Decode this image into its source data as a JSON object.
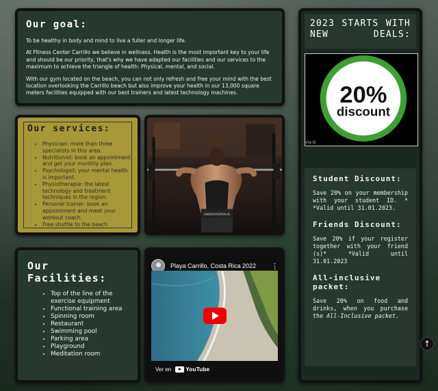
{
  "goal": {
    "title": "Our goal:",
    "paragraphs": [
      "To be healthy in body and mind to live a fuller and longer life.",
      "At Fitness Center Carrillo we believe in wellness. Health is the most important key to your life and should be our priority, that's why we have adapted our facilities and our services to the maximum to achieve the triangle of health: Physical, mental, and social.",
      "With our gym located on the beach, you can not only refresh and free your mind with the best location overlooking the Carrillo beach but also improve your health in our 13,000 square meters facilities equipped with our best trainers and latest technology machines."
    ]
  },
  "services": {
    "title": "Our services:",
    "items": [
      "Physician: more than three specialists in this area.",
      "Nutritionist: book an appointment and get your monthly plan.",
      "Psychologist: your mental health is important.",
      "Physiotherapie: the latest technology and treatment techniques in the region.",
      "Personal trainer: book an appointment and meet your workout coach.",
      "Free shuttle to the beach"
    ]
  },
  "facilities": {
    "title": "Our Facilities:",
    "items": [
      "Top of the line of the exercise equipment",
      "Functional training area",
      "Spinning room",
      "Restaurant",
      "Swimming pool",
      "Parking area",
      "Playground",
      "Meditation room"
    ]
  },
  "video": {
    "title": "Playa Carrillo, Costa Rica 2022",
    "menu_glyph": "⋮",
    "watch_on": "Ver en",
    "youtube_label": "YouTube"
  },
  "deals": {
    "title": "2023 STARTS WITH NEW DEALS:",
    "badge_big": "20%",
    "badge_small": "discount",
    "image_caption": "via G",
    "student": {
      "title": "Student Discount:",
      "text": "Save 20% on your membership with your student ID. * *Valid until 31.01.2023."
    },
    "friends": {
      "title": "Friends Discount:",
      "text": "Save 20% if your register together with your friend (s)* *Valid until 31.01.2023"
    },
    "allinclusive": {
      "title": "All-inclusive packet:",
      "text_prefix": "Save 20% on food and drinks, when you purchase the ",
      "text_em": "All-Inclusive packet."
    }
  },
  "scroll_top_glyph": "↑",
  "colors": {
    "panel": "#27392e",
    "services_bg": "#a79837",
    "badge_green": "#3e9f35",
    "youtube_red": "#e00000"
  }
}
